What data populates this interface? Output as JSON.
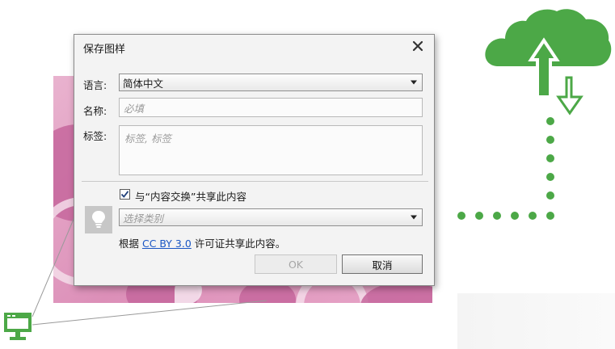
{
  "dialog": {
    "title": "保存图样",
    "close_icon": "close-icon",
    "language": {
      "label": "语言:",
      "value": "简体中文"
    },
    "name": {
      "label": "名称:",
      "placeholder": "必填"
    },
    "tags": {
      "label": "标签:",
      "placeholder": "标签, 标签"
    },
    "share": {
      "checked": true,
      "label": "与“内容交换”共享此内容"
    },
    "category": {
      "placeholder": "选择类别"
    },
    "license": {
      "prefix": "根据 ",
      "link": "CC BY 3.0",
      "suffix": " 许可证共享此内容。"
    },
    "ok_label": "OK",
    "cancel_label": "取消",
    "lightbulb_icon": "lightbulb-icon"
  },
  "decor": {
    "cloud_icon": "cloud-upload-download-icon",
    "monitor_icon": "monitor-icon",
    "accent_color": "#4ca847",
    "pink_color": "#dc8fb8"
  }
}
